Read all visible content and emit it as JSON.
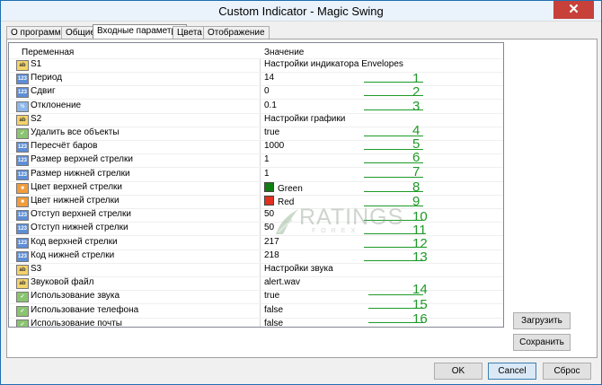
{
  "window": {
    "title": "Custom Indicator - Magic Swing",
    "close_glyph": "✕"
  },
  "tabs": [
    "О программе",
    "Общие",
    "Входные параметры",
    "Цвета",
    "Отображение"
  ],
  "table": {
    "header": {
      "name": "Переменная",
      "value": "Значение"
    },
    "rows": [
      {
        "icon": "ab",
        "name": "S1",
        "value": "Настройки индикатора Envelopes"
      },
      {
        "icon": "123",
        "name": "Период",
        "value": "14"
      },
      {
        "icon": "123",
        "name": "Сдвиг",
        "value": "0"
      },
      {
        "icon": "½",
        "name": "Отклонение",
        "value": "0.1"
      },
      {
        "icon": "ab",
        "name": "S2",
        "value": "Настройки графики"
      },
      {
        "icon": "✓",
        "name": "Удалить все объекты",
        "value": "true"
      },
      {
        "icon": "123",
        "name": "Пересчёт баров",
        "value": "1000"
      },
      {
        "icon": "123",
        "name": "Размер верхней стрелки",
        "value": "1"
      },
      {
        "icon": "123",
        "name": "Размер нижней стрелки",
        "value": "1"
      },
      {
        "icon": "■",
        "name": "Цвет верхней стрелки",
        "value": "Green",
        "swatch": "#0f7f12"
      },
      {
        "icon": "■",
        "name": "Цвет нижней стрелки",
        "value": "Red",
        "swatch": "#e33020"
      },
      {
        "icon": "123",
        "name": "Отступ верхней стрелки",
        "value": "50"
      },
      {
        "icon": "123",
        "name": "Отступ нижней стрелки",
        "value": "50"
      },
      {
        "icon": "123",
        "name": "Код верхней стрелки",
        "value": "217"
      },
      {
        "icon": "123",
        "name": "Код нижней стрелки",
        "value": "218"
      },
      {
        "icon": "ab",
        "name": "S3",
        "value": "Настройки звука"
      },
      {
        "icon": "ab",
        "name": "Звуковой файл",
        "value": "alert.wav"
      },
      {
        "icon": "✓",
        "name": "Использование звука",
        "value": "true"
      },
      {
        "icon": "✓",
        "name": "Использование телефона",
        "value": "false"
      },
      {
        "icon": "✓",
        "name": "Использование почты",
        "value": "false"
      }
    ]
  },
  "annotations": [
    "1",
    "2",
    "3",
    "4",
    "5",
    "6",
    "7",
    "8",
    "9",
    "10",
    "11",
    "12",
    "13",
    "14",
    "15",
    "16"
  ],
  "side_buttons": {
    "load": "Загрузить",
    "save": "Сохранить"
  },
  "bottom_buttons": {
    "ok": "OK",
    "cancel": "Cancel",
    "reset": "Сброс"
  },
  "watermark": {
    "main": "RATINGS",
    "sub": "FOREX"
  },
  "colors": {
    "title_bar": "#eaf2fb",
    "close": "#c7403a",
    "annotation": "#1e9a28"
  }
}
